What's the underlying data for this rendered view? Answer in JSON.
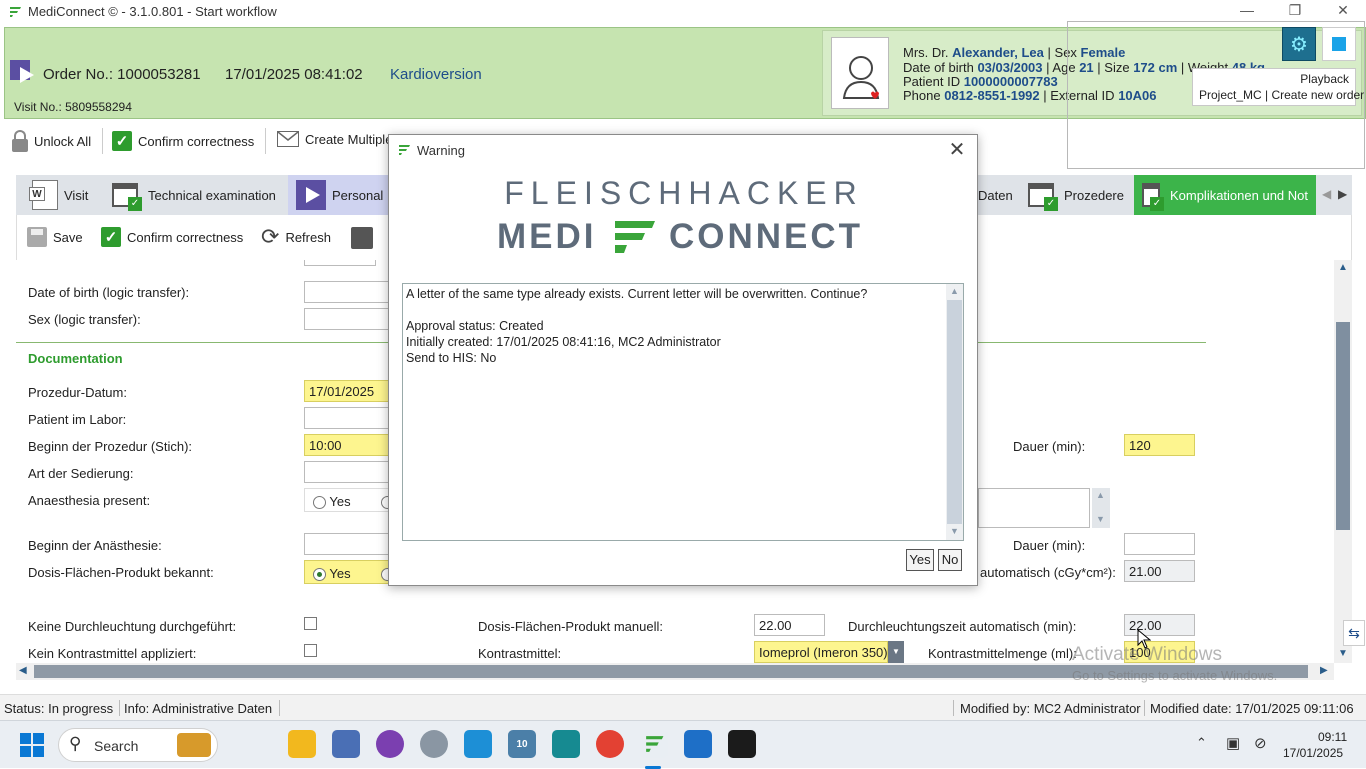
{
  "window": {
    "title": "MediConnect © - 3.1.0.801 - Start workflow"
  },
  "header": {
    "order_label": "Order No.: 1000053281",
    "order_datetime": "17/01/2025 08:41:02",
    "procedure": "Kardioversion",
    "visit": "Visit No.: 5809558294"
  },
  "patient": {
    "prefix": "Mrs. Dr.",
    "name": "Alexander, Lea",
    "sex_label": "| Sex",
    "sex": "Female",
    "dob_label": "Date of birth",
    "dob": "03/03/2003",
    "age_label": "| Age",
    "age": "21",
    "size_label": "| Size",
    "size": "172 cm",
    "weight_label": "| Weight",
    "weight": "48 kg",
    "pid_label": "Patient ID",
    "pid": "1000000007783",
    "phone_label": "Phone",
    "phone": "0812-8551-1992",
    "ext_label": "| External ID",
    "ext": "10A06"
  },
  "playback": {
    "label": "Playback",
    "project": "Project_MC | Create new order"
  },
  "toolbar": {
    "unlock_all": "Unlock All",
    "confirm": "Confirm correctness",
    "create_multiple": "Create Multiple"
  },
  "tabs": {
    "visit": "Visit",
    "technical": "Technical examination",
    "personal": "Personal",
    "daten": "Daten",
    "prozedere": "Prozedere",
    "komplikationen": "Komplikationen und Not"
  },
  "subtoolbar": {
    "save": "Save",
    "confirm": "Confirm correctness",
    "refresh": "Refresh"
  },
  "form": {
    "dob_logic": "Date of birth (logic transfer):",
    "sex_logic": "Sex (logic transfer):",
    "section": "Documentation",
    "prozedur_datum": "Prozedur-Datum:",
    "prozedur_datum_value": "17/01/2025",
    "patient_labor": "Patient im Labor:",
    "beginn_prozedur": "Beginn der Prozedur (Stich):",
    "beginn_prozedur_value": "10:00",
    "dauer1": "Dauer (min):",
    "dauer1_value": "120",
    "art_sedierung": "Art der Sedierung:",
    "anaesthesia": "Anaesthesia present:",
    "anaesthesia_yes": "Yes",
    "beginn_anaesthesie": "Beginn der Anästhesie:",
    "dauer2": "Dauer (min):",
    "dosis_bekannt": "Dosis-Flächen-Produkt bekannt:",
    "dosis_yes": "Yes",
    "dosis_auto_label": "automatisch (cGy*cm²):",
    "dosis_auto_value": "21.00",
    "keine_durchleuchtung": "Keine Durchleuchtung durchgeführt:",
    "dosis_manuell": "Dosis-Flächen-Produkt manuell:",
    "dosis_manuell_value": "22.00",
    "durchleuchtungszeit": "Durchleuchtungszeit automatisch (min):",
    "durchleuchtungszeit_value": "22.00",
    "kein_kontrast": "Kein Kontrastmittel appliziert:",
    "kontrastmittel": "Kontrastmittel:",
    "kontrastmittel_value": "Iomeprol (Imeron 350)",
    "kontrastmenge": "Kontrastmittelmenge (ml):",
    "kontrastmenge_value": "100"
  },
  "dialog": {
    "title": "Warning",
    "brand_top": "FLEISCHHACKER",
    "brand_left": "MEDI",
    "brand_right": "CONNECT",
    "message": "A letter of the same type already exists. Current letter will be overwritten. Continue?\n\nApproval status: Created\nInitially created: 17/01/2025 08:41:16, MC2 Administrator\nSend to HIS: No",
    "yes": "Yes",
    "no": "No"
  },
  "watermark": {
    "line1": "Activate Windows",
    "line2": "Go to Settings to activate Windows."
  },
  "status": {
    "status": "Status: In progress",
    "info": "Info: Administrative Daten",
    "modified_by": "Modified by: MC2 Administrator",
    "modified_date": "Modified date: 17/01/2025 09:11:06"
  },
  "taskbar": {
    "search": "Search",
    "time": "09:11",
    "date": "17/01/2025"
  }
}
